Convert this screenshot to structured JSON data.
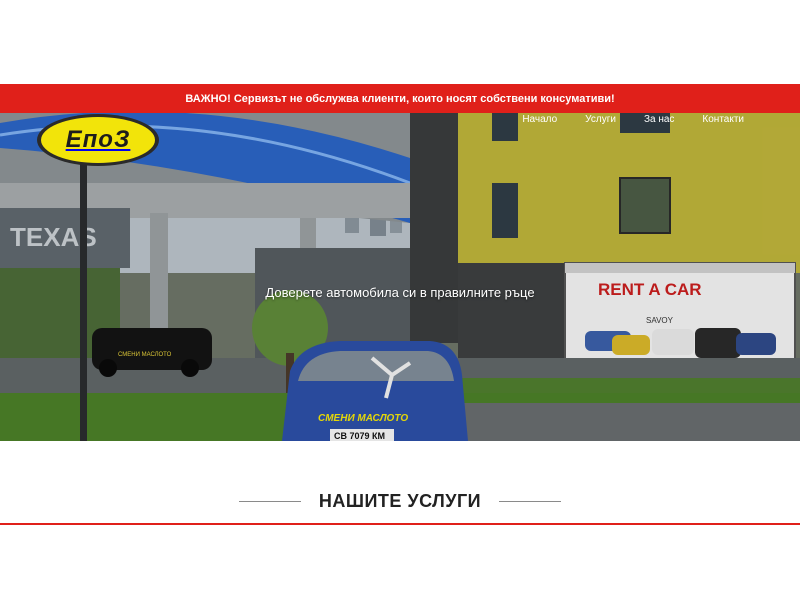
{
  "alert": {
    "text": "ВАЖНО! Сервизът не обслужва клиенти, които носят собствени консумативи!"
  },
  "brand": {
    "logo_text": "ЕпоЗ"
  },
  "nav": {
    "items": [
      {
        "label": "Начало"
      },
      {
        "label": "Услуги"
      },
      {
        "label": "За нас"
      },
      {
        "label": "Контакти"
      }
    ]
  },
  "hero": {
    "tagline": "Доверете автомобила си в правилните ръце",
    "photo": {
      "wall_text": "TEXAS",
      "car_window_text": "СМЕНИ МАСЛОТО",
      "car_plate": "СВ 7079 КМ",
      "billboard_text": "RENT A CAR",
      "billboard_sub": "SAVOY"
    }
  },
  "services": {
    "title": "НАШИТЕ УСЛУГИ"
  },
  "colors": {
    "accent": "#e0201a",
    "logo_yellow": "#f2e40a"
  }
}
